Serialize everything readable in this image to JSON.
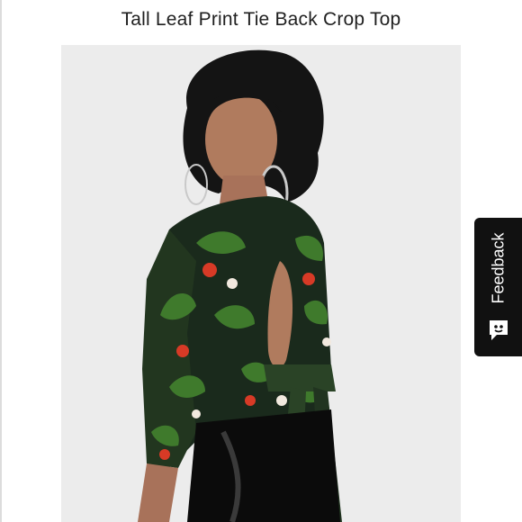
{
  "product": {
    "title": "Tall Leaf Print Tie Back Crop Top"
  },
  "feedback": {
    "label": "Feedback",
    "icon": "smiley-chat-icon"
  },
  "colors": {
    "background": "#ffffff",
    "photo_background": "#ececec",
    "feedback_tab": "#111111"
  }
}
